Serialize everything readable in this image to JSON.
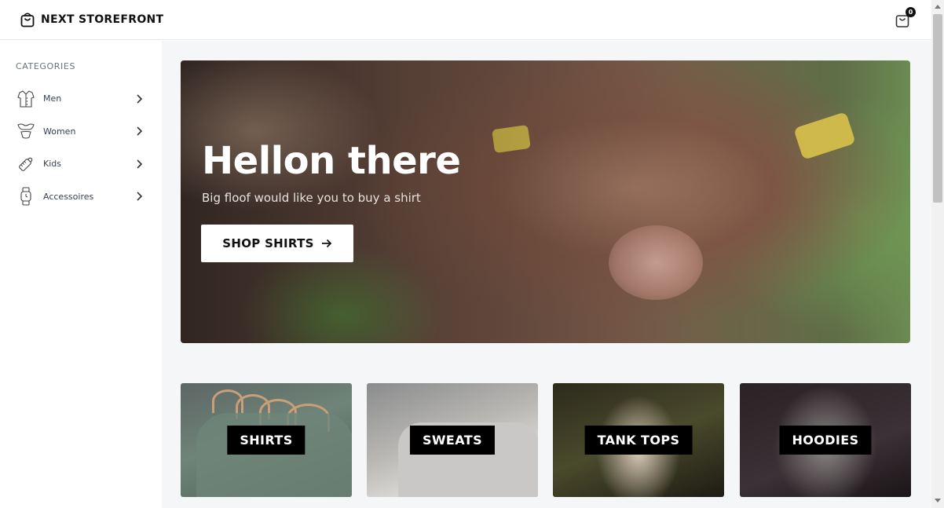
{
  "header": {
    "brand_name": "NEXT STOREFRONT",
    "brand_icon": "shopping-bag-icon",
    "cart_icon": "shopping-bag-icon",
    "cart_count": "0"
  },
  "sidebar": {
    "heading": "CATEGORIES",
    "items": [
      {
        "label": "Men",
        "icon": "shirt-icon"
      },
      {
        "label": "Women",
        "icon": "dress-icon"
      },
      {
        "label": "Kids",
        "icon": "baby-bottle-icon"
      },
      {
        "label": "Accessoires",
        "icon": "watch-icon"
      }
    ]
  },
  "hero": {
    "title": "Hellon there",
    "subtitle": "Big floof would like you to buy a shirt",
    "button_label": "SHOP SHIRTS",
    "button_icon": "arrow-right-icon"
  },
  "tiles": [
    {
      "label": "SHIRTS"
    },
    {
      "label": "SWEATS"
    },
    {
      "label": "TANK TOPS"
    },
    {
      "label": "HOODIES"
    }
  ],
  "colors": {
    "accent": "#000000",
    "background": "#f5f6f8",
    "sidebar_background": "#ffffff"
  }
}
